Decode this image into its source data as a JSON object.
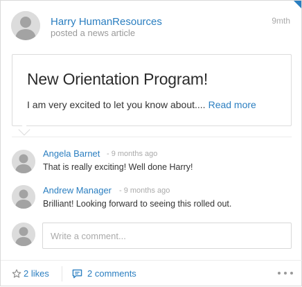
{
  "post": {
    "author_name": "Harry HumanResources",
    "action_text": "posted a news article",
    "timestamp": "9mth",
    "article": {
      "title": "New Orientation Program!",
      "excerpt": "I am very excited to let you know about....",
      "read_more_label": "Read more"
    }
  },
  "comments": [
    {
      "author": "Angela Barnet",
      "time": "- 9 months ago",
      "text": "That is really exciting! Well done Harry!"
    },
    {
      "author": "Andrew Manager",
      "time": "- 9 months ago",
      "text": "Brilliant! Looking forward to seeing this rolled out."
    }
  ],
  "comment_box": {
    "placeholder": "Write a comment..."
  },
  "footer": {
    "likes_label": "2 likes",
    "comments_label": "2 comments"
  },
  "colors": {
    "accent": "#2a7ec0",
    "muted": "#999999",
    "avatar_bg": "#dcdcdc",
    "avatar_fg": "#a3a3a3"
  },
  "icons": {
    "likes": "star-outline-icon",
    "comments": "speech-bubble-icon",
    "more": "ellipsis-icon",
    "avatar": "user-silhouette-icon"
  }
}
